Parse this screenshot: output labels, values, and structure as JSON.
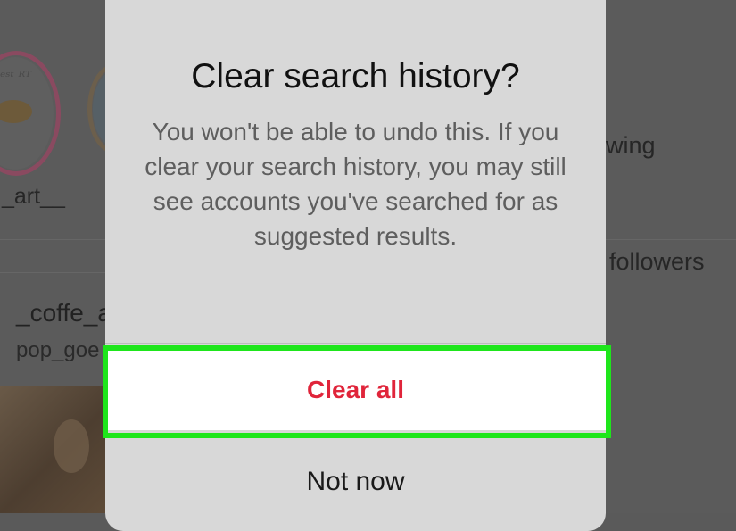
{
  "background": {
    "story_label": "_art__",
    "stat_following": "wing",
    "stat_followers": "followers",
    "result_username": "_coffe_a",
    "result_subtext": "pop_goe"
  },
  "dialog": {
    "title": "Clear search history?",
    "message": "You won't be able to undo this. If you clear your search history, you may still see accounts you've searched for as suggested results.",
    "primary_button": "Clear all",
    "secondary_button": "Not now"
  },
  "colors": {
    "overlay": "#5b5b5b",
    "dialog_bg": "#d8d8d8",
    "primary_button_bg": "#ffffff",
    "destructive_text": "#e0243a",
    "highlight": "#1ee61b"
  },
  "icons": {
    "story_avatar_1": "pastry-illustration-avatar",
    "story_avatar_2": "profile-avatar"
  }
}
